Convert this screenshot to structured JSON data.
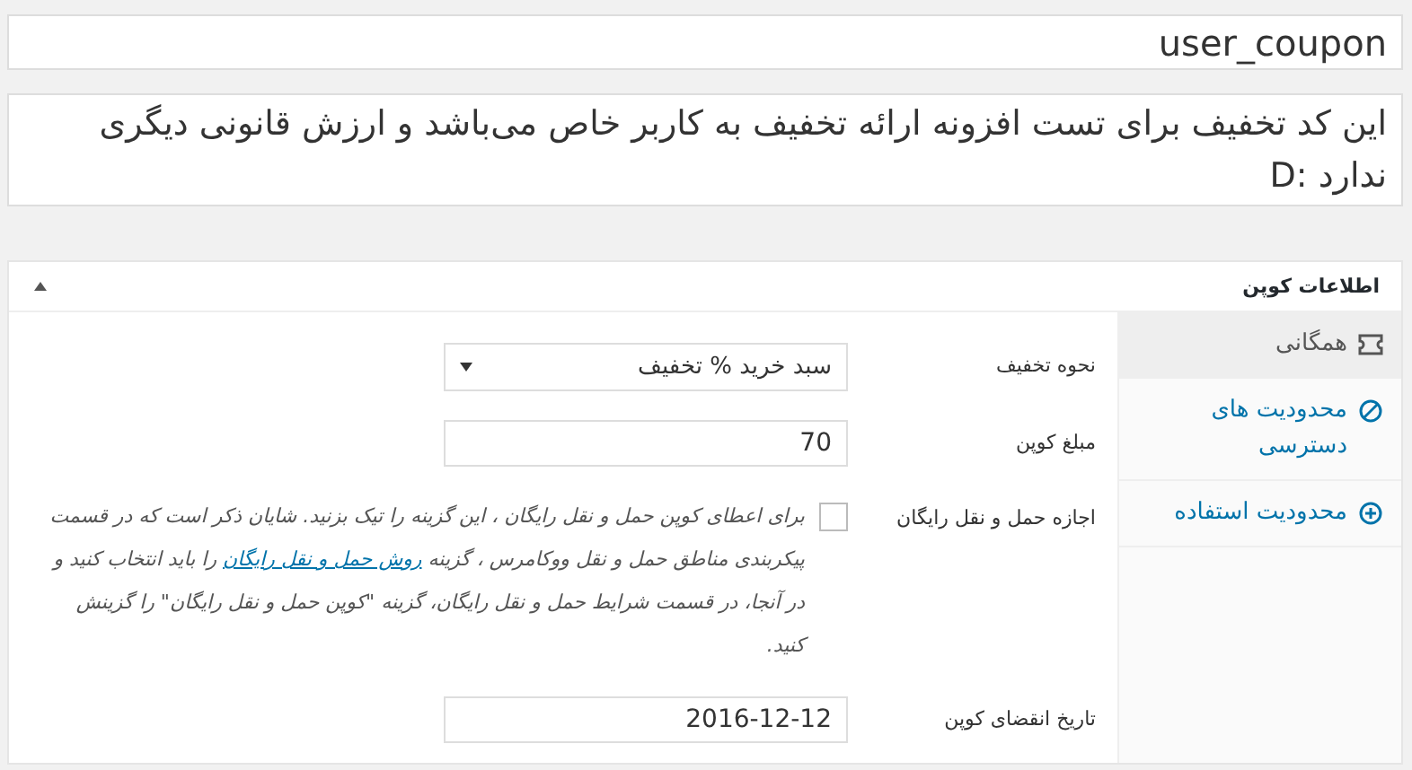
{
  "title_field": {
    "value": "user_coupon"
  },
  "description_field": {
    "value": "این کد تخفیف برای تست افزونه ارائه تخفیف به کاربر خاص می‌باشد و ارزش قانونی دیگری ندارد :D"
  },
  "panel": {
    "title": "اطلاعات کوپن",
    "expanded": true
  },
  "tabs": [
    {
      "label": "همگانی",
      "selected": true
    },
    {
      "label": "محدودیت های دسترسی",
      "selected": false
    },
    {
      "label": "محدودیت استفاده",
      "selected": false
    }
  ],
  "fields": [
    {
      "kind": "select",
      "label": "نحوه تخفیف",
      "value": "سبد خرید % تخفیف"
    },
    {
      "kind": "text",
      "label": "مبلغ کوپن",
      "value": "70"
    },
    {
      "kind": "checkbox",
      "label": "اجازه حمل و نقل رایگان",
      "checked": false,
      "help_before": "برای اعطای کوپن حمل و نقل رایگان ، این گزینه را تیک بزنید. شایان ذکر است که در قسمت پیکربندی مناطق حمل و نقل ووکامرس ، گزینه",
      "help_link": "روش حمل و نقل رایگان",
      "help_after": "را باید انتخاب کنید و در آنجا، در قسمت شرایط حمل و نقل رایگان، گزینه \"کوپن حمل و نقل رایگان\" را گزینش کنید."
    },
    {
      "kind": "text",
      "label": "تاریخ انقضای کوپن",
      "value": "2016-12-12"
    }
  ]
}
